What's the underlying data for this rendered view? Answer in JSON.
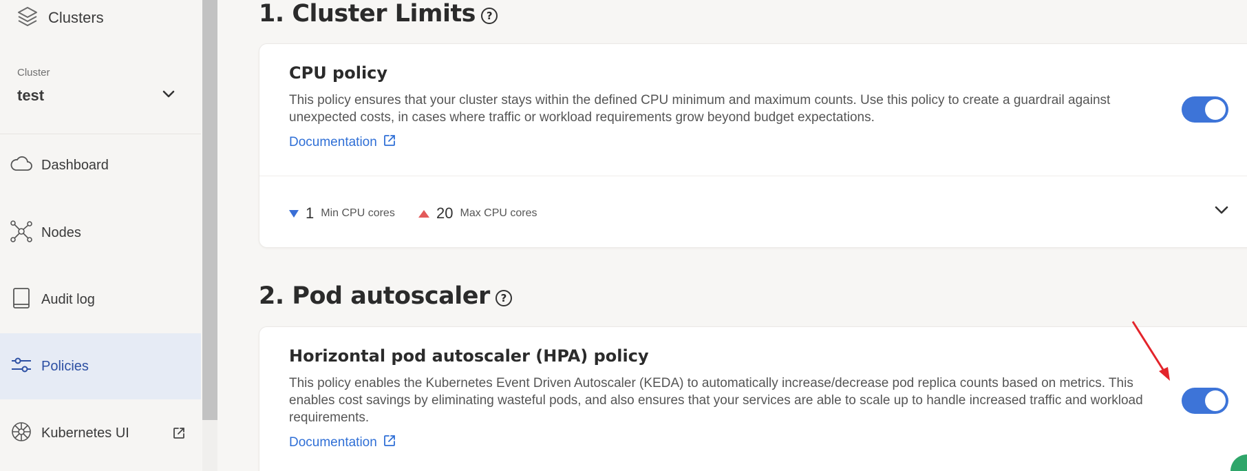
{
  "sidebar": {
    "brand": {
      "label": "Clusters",
      "icon": "layers-icon"
    },
    "cluster_selector": {
      "label": "Cluster",
      "value": "test",
      "icon": "chevron-down-icon"
    },
    "items": [
      {
        "label": "Dashboard",
        "icon": "cloud-icon",
        "active": false
      },
      {
        "label": "Nodes",
        "icon": "network-nodes-icon",
        "active": false
      },
      {
        "label": "Audit log",
        "icon": "book-icon",
        "active": false
      },
      {
        "label": "Policies",
        "icon": "sliders-icon",
        "active": true
      },
      {
        "label": "Kubernetes UI",
        "icon": "kubernetes-helm-icon",
        "active": false,
        "external_icon": "external-link-icon"
      }
    ]
  },
  "sections": [
    {
      "title": "1. Cluster Limits",
      "help_icon": "question-circle-icon",
      "card": {
        "title": "CPU policy",
        "description": "This policy ensures that your cluster stays within the defined CPU minimum and maximum counts. Use this policy to create a guardrail against unexpected costs, in cases where traffic or workload requirements grow beyond budget expectations.",
        "doc_link": "Documentation",
        "enabled": true,
        "min": {
          "value": "1",
          "label": "Min CPU cores"
        },
        "max": {
          "value": "20",
          "label": "Max CPU cores"
        }
      }
    },
    {
      "title": "2. Pod autoscaler",
      "help_icon": "question-circle-icon",
      "card": {
        "title": "Horizontal pod autoscaler (HPA) policy",
        "description": "This policy enables the Kubernetes Event Driven Autoscaler (KEDA) to automatically increase/decrease pod replica counts based on metrics. This enables cost savings by eliminating wasteful pods, and also ensures that your services are able to scale up to handle increased traffic and workload requirements.",
        "doc_link": "Documentation",
        "enabled": true
      }
    }
  ],
  "colors": {
    "accent": "#3d74d8",
    "link": "#2f6fd6",
    "active_nav_bg": "#e6ebf5",
    "min_indicator": "#3a6fd6",
    "max_indicator": "#e35a5a",
    "annotation_arrow": "#e3242b"
  }
}
